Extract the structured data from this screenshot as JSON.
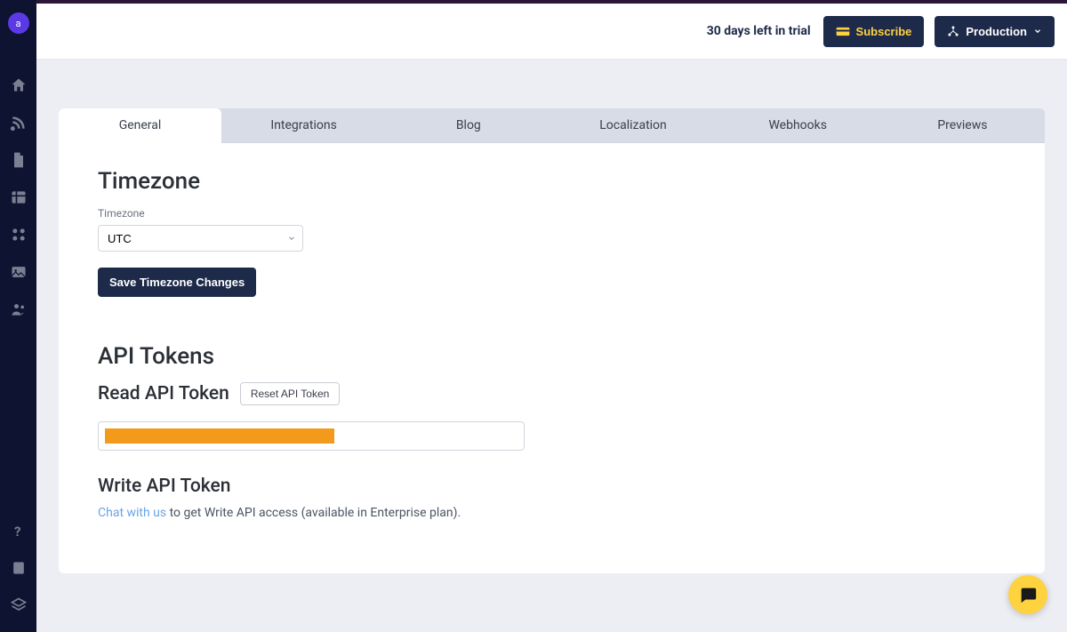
{
  "sidebar": {
    "avatar_letter": "a"
  },
  "header": {
    "trial_text": "30 days left in trial",
    "subscribe_label": "Subscribe",
    "environment_label": "Production"
  },
  "tabs": [
    {
      "label": "General",
      "active": true
    },
    {
      "label": "Integrations",
      "active": false
    },
    {
      "label": "Blog",
      "active": false
    },
    {
      "label": "Localization",
      "active": false
    },
    {
      "label": "Webhooks",
      "active": false
    },
    {
      "label": "Previews",
      "active": false
    }
  ],
  "timezone_section": {
    "title": "Timezone",
    "field_label": "Timezone",
    "selected_value": "UTC",
    "save_button": "Save Timezone Changes"
  },
  "api_tokens_section": {
    "title": "API Tokens",
    "read_title": "Read API Token",
    "reset_button": "Reset API Token",
    "write_title": "Write API Token",
    "write_link_text": "Chat with us",
    "write_rest": " to get Write API access (available in Enterprise plan)."
  }
}
